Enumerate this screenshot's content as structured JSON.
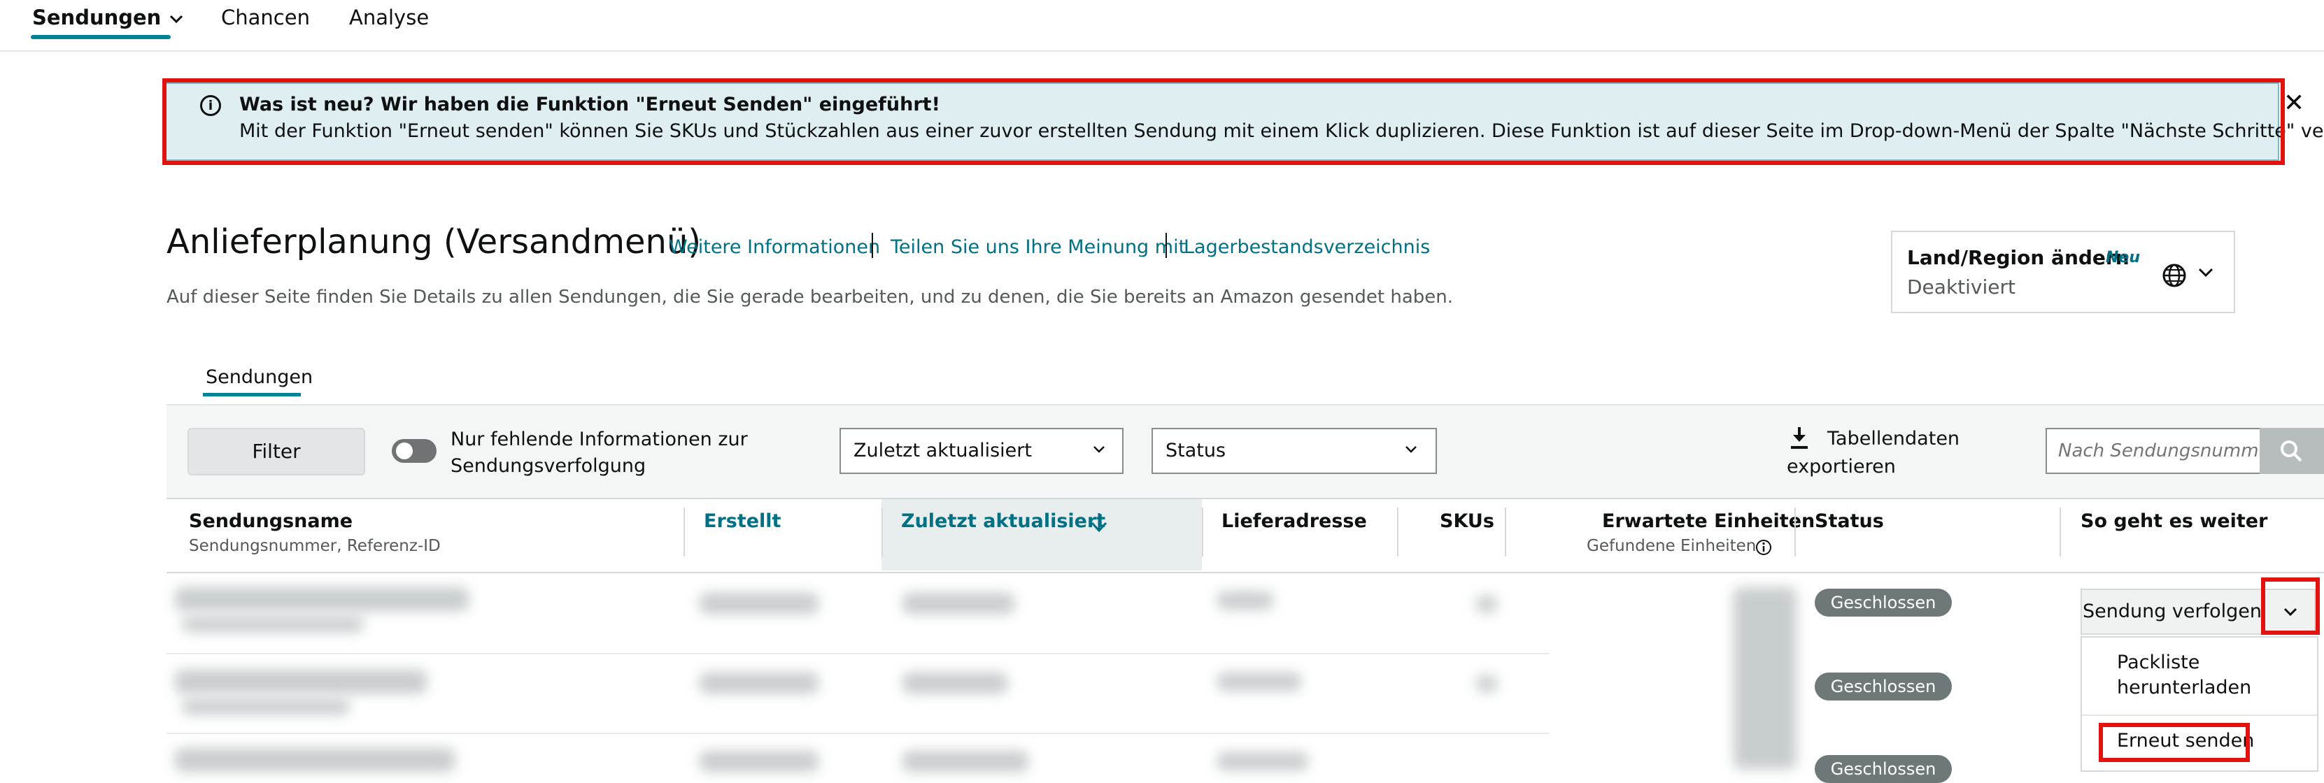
{
  "nav": {
    "tabs": [
      {
        "label": "Sendungen"
      },
      {
        "label": "Chancen"
      },
      {
        "label": "Analyse"
      }
    ]
  },
  "alert": {
    "title": "Was ist neu? Wir haben die Funktion \"Erneut Senden\" eingeführt!",
    "body": "Mit der Funktion \"Erneut senden\" können Sie SKUs und Stückzahlen aus einer zuvor erstellten Sendung mit einem Klick duplizieren. Diese Funktion ist auf dieser Seite im Drop-down-Menü der Spalte \"Nächste Schritte\" verfügbar.",
    "close": "✕",
    "info_glyph": "i"
  },
  "header": {
    "title": "Anlieferplanung (Versandmenü)",
    "links": [
      "Weitere Informationen",
      "Teilen Sie uns Ihre Meinung mit",
      "Lagerbestandsverzeichnis"
    ],
    "description": "Auf dieser Seite finden Sie Details zu allen Sendungen, die Sie gerade bearbeiten, und zu denen, die Sie bereits an Amazon gesendet haben."
  },
  "region": {
    "title": "Land/Region ändern",
    "badge": "Neu",
    "status": "Deaktiviert",
    "icon": "globe-icon"
  },
  "section_tab": "Sendungen",
  "toolbar": {
    "filter_label": "Filter",
    "toggle_label_line1": "Nur fehlende Informationen zur",
    "toggle_label_line2": "Sendungsverfolgung",
    "sort_select": "Zuletzt aktualisiert",
    "status_select": "Status",
    "export_line1": "Tabellendaten",
    "export_line2": "exportieren",
    "search_placeholder": "Nach Sendungsnummer suchen"
  },
  "table": {
    "columns": {
      "name": "Sendungsname",
      "name_sub": "Sendungsnummer, Referenz-ID",
      "created": "Erstellt",
      "updated": "Zuletzt aktualisiert",
      "address": "Lieferadresse",
      "skus": "SKUs",
      "expected": "Erwartete Einheiten",
      "expected_sub": "Gefundene Einheiten",
      "status": "Status",
      "next": "So geht es weiter"
    },
    "rows": [
      {
        "status": "Geschlossen"
      },
      {
        "status": "Geschlossen"
      },
      {
        "status": "Geschlossen"
      }
    ]
  },
  "next_steps": {
    "button": "Sendung verfolgen",
    "menu": {
      "item1_line1": "Packliste",
      "item1_line2": "herunterladen",
      "item2": "Erneut senden"
    }
  },
  "colors": {
    "accent": "#008296",
    "link": "#007185",
    "highlight": "#e2120f",
    "badge": "#6f7878"
  }
}
